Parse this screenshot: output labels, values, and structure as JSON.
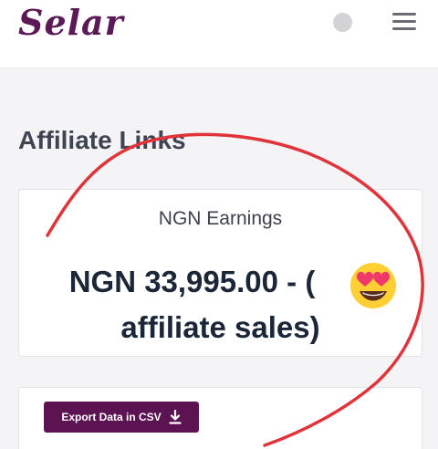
{
  "header": {
    "logo_text": "Selar",
    "brand_color": "#5b1a55",
    "avatar_icon": "avatar-placeholder",
    "menu_icon": "hamburger-menu-icon"
  },
  "main": {
    "section_title": "Affiliate Links",
    "earnings": {
      "label": "NGN Earnings",
      "value": "NGN 33,995.00 - (",
      "value_suffix": "affiliate sales)"
    },
    "export": {
      "button_label": "Export Data in CSV",
      "icon": "download-icon",
      "button_color": "#5c1352"
    }
  },
  "overlay": {
    "annotation_color": "#e0333a",
    "emoji": "heart-eyes-emoji"
  }
}
